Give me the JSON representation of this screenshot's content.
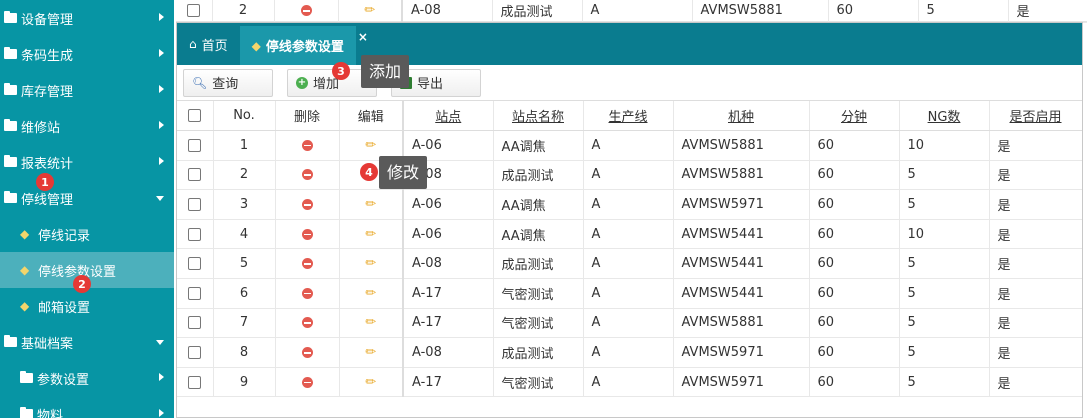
{
  "sidebar": {
    "items": [
      {
        "label": "设备管理",
        "type": "folder",
        "arrow": "right"
      },
      {
        "label": "条码生成",
        "type": "folder",
        "arrow": "right"
      },
      {
        "label": "库存管理",
        "type": "folder",
        "arrow": "right"
      },
      {
        "label": "维修站",
        "type": "folder",
        "arrow": "right"
      },
      {
        "label": "报表统计",
        "type": "folder",
        "arrow": "right"
      },
      {
        "label": "停线管理",
        "type": "folder",
        "arrow": "down"
      },
      {
        "label": "停线记录",
        "type": "tag"
      },
      {
        "label": "停线参数设置",
        "type": "tag",
        "active": true
      },
      {
        "label": "邮箱设置",
        "type": "tag"
      },
      {
        "label": "基础档案",
        "type": "folder",
        "arrow": "down"
      },
      {
        "label": "参数设置",
        "type": "folder",
        "arrow": "right",
        "sub": true
      },
      {
        "label": "物料",
        "type": "folder",
        "arrow": "right",
        "sub": true
      }
    ]
  },
  "badges": [
    "1",
    "2",
    "3",
    "4"
  ],
  "tooltips": {
    "add": "添加",
    "edit": "修改"
  },
  "tabs": [
    {
      "label": "首页",
      "icon": "home-icon"
    },
    {
      "label": "停线参数设置",
      "icon": "tag-icon",
      "active": true
    }
  ],
  "tab_close": "×",
  "toolbar": {
    "query": "查询",
    "add": "增加",
    "export": "导出"
  },
  "table": {
    "headers": [
      "No.",
      "删除",
      "编辑",
      "站点",
      "站点名称",
      "生产线",
      "机种",
      "分钟",
      "NG数",
      "是否启用"
    ],
    "top_row": {
      "no": "2",
      "station": "A-08",
      "name": "成品测试",
      "line": "A",
      "model": "AVMSW5881",
      "minutes": "60",
      "ng": "5",
      "enabled": "是"
    },
    "rows": [
      {
        "no": "1",
        "station": "A-06",
        "name": "AA调焦",
        "line": "A",
        "model": "AVMSW5881",
        "minutes": "60",
        "ng": "10",
        "enabled": "是"
      },
      {
        "no": "2",
        "station": "A-08",
        "name": "成品测试",
        "line": "A",
        "model": "AVMSW5881",
        "minutes": "60",
        "ng": "5",
        "enabled": "是"
      },
      {
        "no": "3",
        "station": "A-06",
        "name": "AA调焦",
        "line": "A",
        "model": "AVMSW5971",
        "minutes": "60",
        "ng": "5",
        "enabled": "是"
      },
      {
        "no": "4",
        "station": "A-06",
        "name": "AA调焦",
        "line": "A",
        "model": "AVMSW5441",
        "minutes": "60",
        "ng": "10",
        "enabled": "是"
      },
      {
        "no": "5",
        "station": "A-08",
        "name": "成品测试",
        "line": "A",
        "model": "AVMSW5441",
        "minutes": "60",
        "ng": "5",
        "enabled": "是"
      },
      {
        "no": "6",
        "station": "A-17",
        "name": "气密测试",
        "line": "A",
        "model": "AVMSW5441",
        "minutes": "60",
        "ng": "5",
        "enabled": "是"
      },
      {
        "no": "7",
        "station": "A-17",
        "name": "气密测试",
        "line": "A",
        "model": "AVMSW5881",
        "minutes": "60",
        "ng": "5",
        "enabled": "是"
      },
      {
        "no": "8",
        "station": "A-08",
        "name": "成品测试",
        "line": "A",
        "model": "AVMSW5971",
        "minutes": "60",
        "ng": "5",
        "enabled": "是"
      },
      {
        "no": "9",
        "station": "A-17",
        "name": "气密测试",
        "line": "A",
        "model": "AVMSW5971",
        "minutes": "60",
        "ng": "5",
        "enabled": "是"
      }
    ]
  },
  "colors": {
    "sidebar": "#0795a4",
    "sidebar_active": "#4cb0bc",
    "tabbar": "#0a7c8f",
    "badge": "#e53935"
  }
}
